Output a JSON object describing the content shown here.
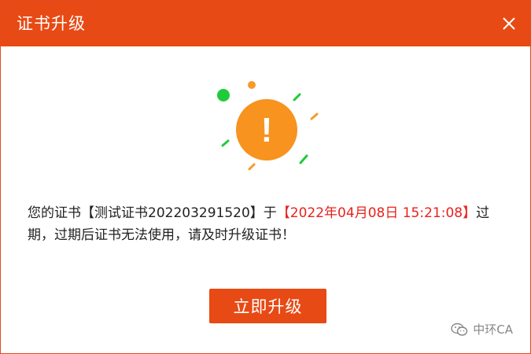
{
  "window": {
    "title": "证书升级",
    "close_icon": "close-icon"
  },
  "graphic": {
    "icon": "exclamation-warning-icon",
    "symbol": "!",
    "colors": {
      "circle": "#f7931e",
      "green": "#1fcb3a",
      "orange": "#f79a2b"
    }
  },
  "message": {
    "part1": "您的证书【测试证书202203291520】于",
    "date": "【2022年04月08日 15:21:08】",
    "part2": "过期，过期后证书无法使用，请及时升级证书！"
  },
  "actions": {
    "upgrade_label": "立即升级"
  },
  "watermark": {
    "icon": "wechat-icon",
    "text": "中环CA"
  },
  "colors": {
    "accent": "#e84a15",
    "date_red": "#e8221c"
  }
}
